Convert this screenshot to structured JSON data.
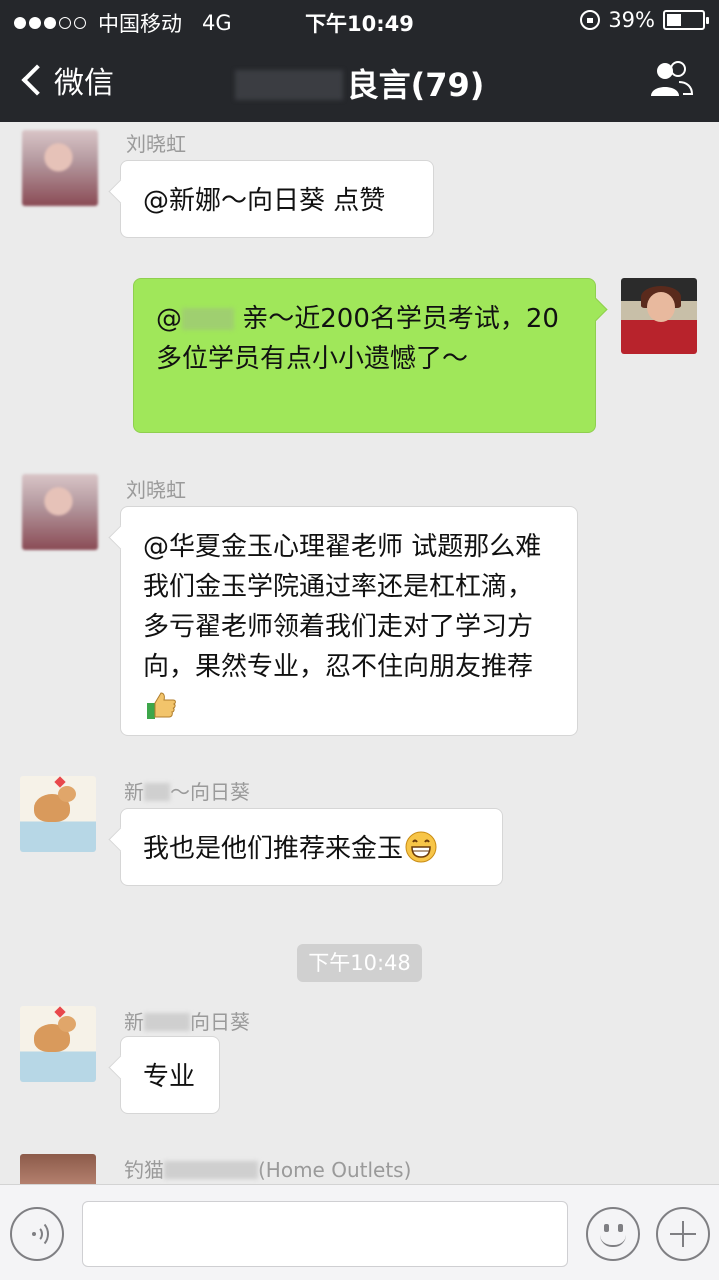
{
  "status_bar": {
    "carrier": "中国移动",
    "network": "4G",
    "time": "下午10:49",
    "battery": "39%",
    "battery_level": 0.39
  },
  "nav": {
    "back_label": "微信",
    "title_visible": "良言",
    "member_count": "(79)"
  },
  "messages": [
    {
      "sender": "刘晓虹",
      "side": "left",
      "avatar": "avatar-girl",
      "text": "@新娜～向日葵 点赞"
    },
    {
      "sender": "",
      "side": "right",
      "avatar": "avatar-self",
      "text_prefix": "@",
      "text": "亲～近200名学员考试，20多位学员有点小小遗憾了～"
    },
    {
      "sender": "刘晓虹",
      "side": "left",
      "avatar": "avatar-girl",
      "text": "@华夏金玉心理翟老师 试题那么难我们金玉学院通过率还是杠杠滴，多亏翟老师领着我们走对了学习方向，果然专业，忍不住向朋友推荐",
      "emoji": "thumbs-up-icon"
    },
    {
      "sender_prefix": "新",
      "sender_suffix": "～向日葵",
      "side": "left",
      "avatar": "avatar-cat",
      "text": "我也是他们推荐来金玉",
      "emoji": "grin-icon"
    },
    {
      "sender_prefix": "新",
      "sender_suffix": "向日葵",
      "side": "left",
      "avatar": "avatar-cat",
      "text": "专业"
    },
    {
      "sender_prefix": "钓猫",
      "sender_suffix": "(Home Outlets)",
      "side": "left",
      "avatar": "avatar-brown",
      "text": ""
    }
  ],
  "timestamp": "下午10:48",
  "input_bar": {
    "voice_icon": "voice-icon",
    "emoji_icon": "emoji-icon",
    "plus_icon": "plus-icon",
    "placeholder": ""
  },
  "colors": {
    "nav_bg": "#25272b",
    "chat_bg": "#ebebeb",
    "self_bubble": "#a0e75a",
    "other_bubble": "#ffffff"
  }
}
